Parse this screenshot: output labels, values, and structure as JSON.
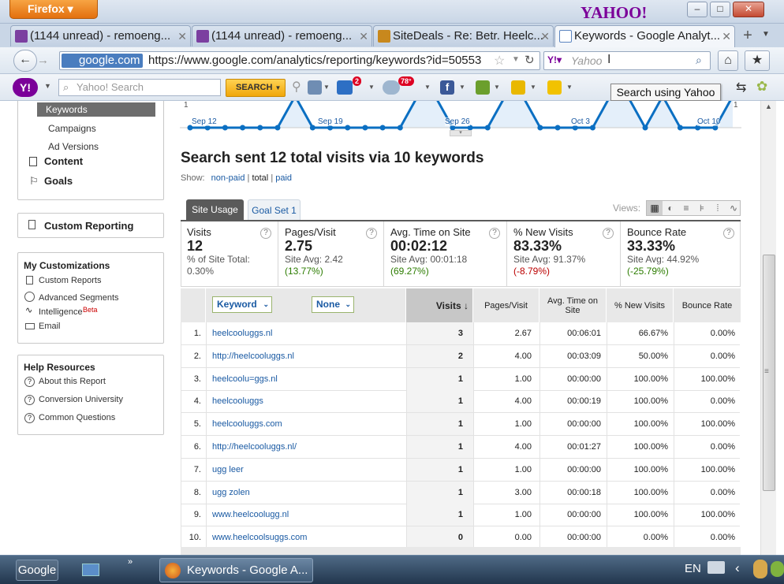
{
  "window": {
    "menu_button": "Firefox",
    "brand": "YAHOO!",
    "controls": [
      "–",
      "□",
      "✕"
    ]
  },
  "tabs": [
    {
      "label": "(1144 unread) - remoeng...",
      "active": false,
      "icon": "yahoo-mail-icon"
    },
    {
      "label": "(1144 unread) - remoeng...",
      "active": false,
      "icon": "yahoo-mail-icon"
    },
    {
      "label": "SiteDeals - Re: Betr. Heelc...",
      "active": false,
      "icon": "sitedeals-icon"
    },
    {
      "label": "Keywords - Google Analyt...",
      "active": true,
      "icon": "analytics-icon"
    }
  ],
  "new_tab": "+",
  "nav": {
    "url_site": "google.com",
    "url": "https://www.google.com/analytics/reporting/keywords?id=50553",
    "search_placeholder": "Yahoo"
  },
  "yahoo_toolbar": {
    "search_placeholder": "Yahoo! Search",
    "search_button": "SEARCH",
    "mail_badge": "2",
    "weather_badge": "78°"
  },
  "tooltip": "Search using Yahoo",
  "sidebar": {
    "keywords": "Keywords",
    "campaigns": "Campaigns",
    "ad_versions": "Ad Versions",
    "content": "Content",
    "goals": "Goals",
    "custom_reporting": "Custom Reporting",
    "my_customizations": {
      "title": "My Customizations",
      "items": [
        "Custom Reports",
        "Advanced Segments",
        "Intelligence",
        "Email"
      ],
      "beta": "Beta"
    },
    "help": {
      "title": "Help Resources",
      "items": [
        "About this Report",
        "Conversion University",
        "Common Questions"
      ]
    }
  },
  "chart": {
    "y_label_left": "1",
    "y_label_right": "1",
    "dates": [
      "Sep 12",
      "Sep 19",
      "Sep 26",
      "Oct 3",
      "Oct 10"
    ],
    "values": [
      0,
      0,
      0,
      0,
      0,
      0,
      1,
      0,
      0,
      0,
      0,
      0,
      0,
      1,
      1,
      0,
      0,
      0,
      1,
      1,
      0,
      0,
      0,
      0,
      1,
      1,
      0,
      1,
      0,
      0,
      0,
      1
    ]
  },
  "heading": "Search sent 12 total visits via 10 keywords",
  "show": {
    "label": "Show:",
    "non_paid": "non-paid",
    "sep1": "|",
    "total": "total",
    "sep2": "|",
    "paid": "paid"
  },
  "tabs_report": {
    "site_usage": "Site Usage",
    "goal_set": "Goal Set 1",
    "views": "Views:"
  },
  "metrics": [
    {
      "label": "Visits",
      "value": "12",
      "sub1": "% of Site Total:",
      "sub2": "0.30%",
      "sub2_color": "gray"
    },
    {
      "label": "Pages/Visit",
      "value": "2.75",
      "sub1": "Site Avg: 2.42",
      "sub2": "(13.77%)",
      "sub2_color": "green"
    },
    {
      "label": "Avg. Time on Site",
      "value": "00:02:12",
      "sub1": "Site Avg: 00:01:18",
      "sub2": "(69.27%)",
      "sub2_color": "green"
    },
    {
      "label": "% New Visits",
      "value": "83.33%",
      "sub1": "Site Avg: 91.37%",
      "sub2": "(-8.79%)",
      "sub2_color": "red"
    },
    {
      "label": "Bounce Rate",
      "value": "33.33%",
      "sub1": "Site Avg: 44.92%",
      "sub2": "(-25.79%)",
      "sub2_color": "green"
    }
  ],
  "table": {
    "dim1": "Keyword",
    "dim2": "None",
    "headers": [
      "Visits",
      "Pages/Visit",
      "Avg. Time on Site",
      "% New Visits",
      "Bounce Rate"
    ],
    "rows": [
      {
        "n": "1.",
        "kw": "heelcooluggs.nl",
        "visits": "3",
        "ppv": "2.67",
        "time": "00:06:01",
        "new": "66.67%",
        "bounce": "0.00%"
      },
      {
        "n": "2.",
        "kw": "http://heelcooluggs.nl",
        "visits": "2",
        "ppv": "4.00",
        "time": "00:03:09",
        "new": "50.00%",
        "bounce": "0.00%"
      },
      {
        "n": "3.",
        "kw": "heelcoolu=ggs.nl",
        "visits": "1",
        "ppv": "1.00",
        "time": "00:00:00",
        "new": "100.00%",
        "bounce": "100.00%"
      },
      {
        "n": "4.",
        "kw": "heelcooluggs",
        "visits": "1",
        "ppv": "4.00",
        "time": "00:00:19",
        "new": "100.00%",
        "bounce": "0.00%"
      },
      {
        "n": "5.",
        "kw": "heelcooluggs.com",
        "visits": "1",
        "ppv": "1.00",
        "time": "00:00:00",
        "new": "100.00%",
        "bounce": "100.00%"
      },
      {
        "n": "6.",
        "kw": "http://heelcooluggs.nl/",
        "visits": "1",
        "ppv": "4.00",
        "time": "00:01:27",
        "new": "100.00%",
        "bounce": "0.00%"
      },
      {
        "n": "7.",
        "kw": "ugg leer",
        "visits": "1",
        "ppv": "1.00",
        "time": "00:00:00",
        "new": "100.00%",
        "bounce": "100.00%"
      },
      {
        "n": "8.",
        "kw": "ugg zolen",
        "visits": "1",
        "ppv": "3.00",
        "time": "00:00:18",
        "new": "100.00%",
        "bounce": "0.00%"
      },
      {
        "n": "9.",
        "kw": "www.heelcoolugg.nl",
        "visits": "1",
        "ppv": "1.00",
        "time": "00:00:00",
        "new": "100.00%",
        "bounce": "100.00%"
      },
      {
        "n": "10.",
        "kw": "www.heelcoolsuggs.com",
        "visits": "0",
        "ppv": "0.00",
        "time": "00:00:00",
        "new": "0.00%",
        "bounce": "0.00%"
      }
    ]
  },
  "taskbar": {
    "google": "Google",
    "window": "Keywords - Google A...",
    "lang": "EN"
  },
  "colors": {
    "chart_line": "#0b6fc2",
    "chart_fill": "#e4effa",
    "link": "#1a5aa3",
    "green": "#2c7c00",
    "red": "#b00000"
  }
}
